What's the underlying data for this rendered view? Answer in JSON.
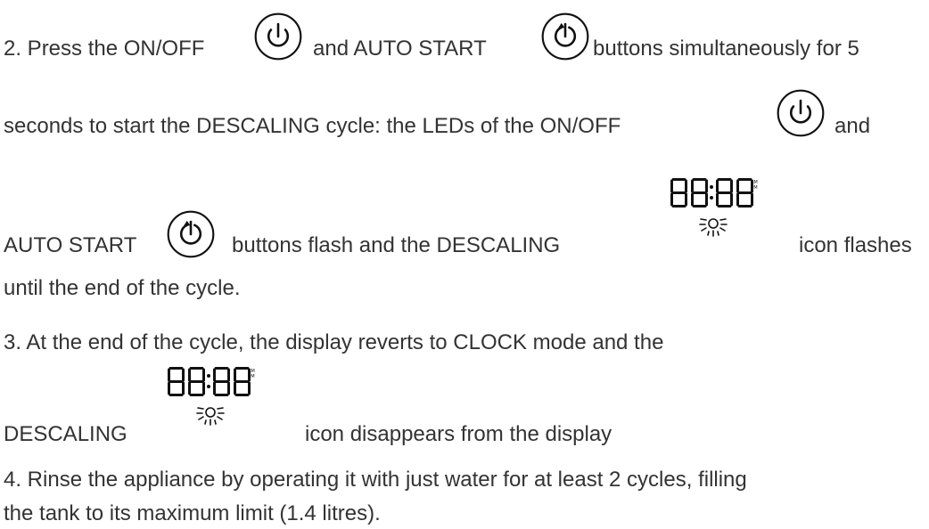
{
  "step2": {
    "line1_part1": "2. Press the ON/OFF",
    "line1_part2": "and AUTO START",
    "line1_part3": "buttons simultaneously for 5",
    "line2_part1": "seconds to start the DESCALING cycle: the LEDs of the ON/OFF",
    "line2_part2": "and",
    "line3_part1": "AUTO START",
    "line3_part2": "buttons flash and the DESCALING",
    "line3_part3": "icon flashes",
    "line4": "until the end of the cycle."
  },
  "step3": {
    "line1": "3. At the end of the cycle, the display reverts to CLOCK mode and the",
    "line2_part1": "DESCALING",
    "line2_part2": "icon disappears from the display"
  },
  "step4": {
    "line1": "4. Rinse the appliance by operating it with just water for at least 2 cycles, filling",
    "line2": "the tank to its maximum limit (1.4 litres)."
  },
  "display": {
    "digits": "88:88",
    "am": "AM",
    "pm": "PM"
  },
  "icons": {
    "on_off": "power-icon",
    "auto_start": "auto-start-icon",
    "descaling": "descaling-display-icon"
  },
  "colors": {
    "text": "#333333",
    "icon": "#111111"
  }
}
